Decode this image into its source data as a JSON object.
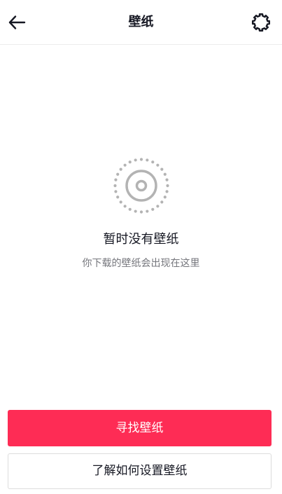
{
  "header": {
    "title": "壁纸",
    "back_icon": "back-arrow-icon",
    "settings_icon": "gear-icon"
  },
  "empty_state": {
    "icon": "wallpaper-empty-icon",
    "title": "暂时没有壁纸",
    "subtitle": "你下载的壁纸会出现在这里"
  },
  "actions": {
    "primary_label": "寻找壁纸",
    "secondary_label": "了解如何设置壁纸"
  },
  "colors": {
    "accent": "#fe2c55",
    "text_primary": "#161823",
    "text_secondary": "#75767c",
    "icon_gray": "#b3b3b3"
  }
}
